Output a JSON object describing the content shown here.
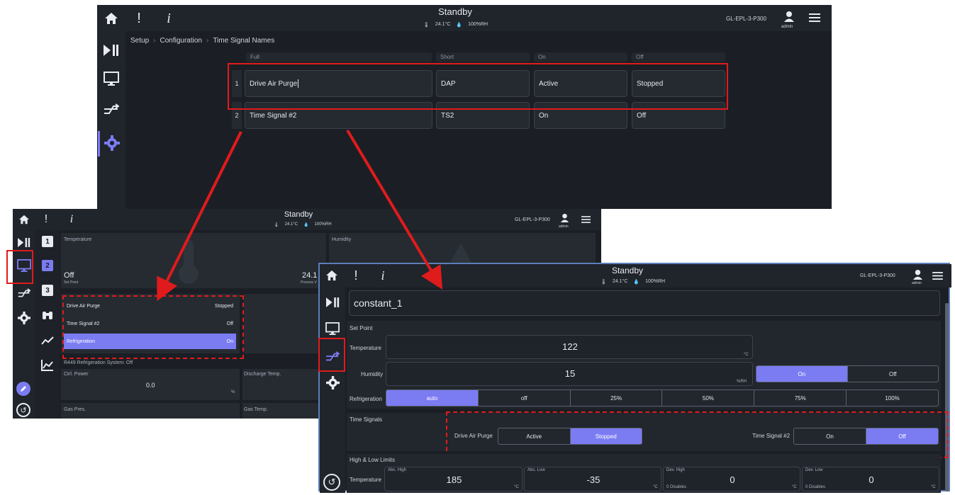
{
  "top": {
    "status": "Standby",
    "temp": "24.1°C",
    "humidity": "100%RH",
    "device": "GL-EPL-3-P300",
    "user": "admin",
    "breadcrumb": [
      "Setup",
      "Configuration",
      "Time Signal Names"
    ],
    "columns": [
      "Full",
      "Short",
      "On",
      "Off"
    ],
    "rows": [
      {
        "num": "1",
        "full": "Drive Air Purge",
        "short": "DAP",
        "on": "Active",
        "off": "Stopped"
      },
      {
        "num": "2",
        "full": "Time Signal #2",
        "short": "TS2",
        "on": "On",
        "off": "Off"
      }
    ]
  },
  "left": {
    "status": "Standby",
    "temp": "24.1°C",
    "humidity": "100%RH",
    "device": "GL-EPL-3-P300",
    "user": "admin",
    "tabs": [
      "1",
      "2",
      "3"
    ],
    "temperature_title": "Temperature",
    "humidity_title": "Humidity",
    "temp_setpoint_value": "Off",
    "temp_setpoint_label": "Set Point",
    "temp_process_value": "24.1",
    "temp_process_label": "Process V",
    "signals": [
      {
        "name": "Drive Air Purge",
        "state": "Stopped",
        "active": false
      },
      {
        "name": "Time Signal #2",
        "state": "Off",
        "active": false
      },
      {
        "name": "Refrigeration",
        "state": "On",
        "active": true
      }
    ],
    "refrig_system": "R449 Refrigeration System: Off",
    "ctrl_power_label": "Ctrl. Power",
    "ctrl_power_value": "0.0",
    "ctrl_power_unit": "%",
    "discharge_label": "Discharge Temp.",
    "gas_pres_label": "Gas Pres.",
    "gas_temp_label": "Gas Temp."
  },
  "right": {
    "status": "Standby",
    "temp": "24.1°C",
    "humidity": "100%RH",
    "device": "GL-EPL-3-P300",
    "user": "admin",
    "name": "constant_1",
    "setpoint_title": "Set Point",
    "temperature_label": "Temperature",
    "temperature_value": "122",
    "temperature_unit": "°C",
    "humidity_label": "Humidity",
    "humidity_value": "15",
    "humidity_unit": "%RH",
    "humidity_on": "On",
    "humidity_off": "Off",
    "refrigeration_label": "Refrigeration",
    "refrigeration_options": [
      "auto",
      "off",
      "25%",
      "50%",
      "75%",
      "100%"
    ],
    "time_signals_title": "Time Signals",
    "ts1_label": "Drive Air Purge",
    "ts1_options": [
      "Active",
      "Stopped"
    ],
    "ts2_label": "Time Signal #2",
    "ts2_options": [
      "On",
      "Off"
    ],
    "limits_title": "High & Low Limits",
    "limits_row_label": "Temperature",
    "abs_high_label": "Abs. High",
    "abs_high_value": "185",
    "abs_low_label": "Abs. Low",
    "abs_low_value": "-35",
    "dev_high_label": "Dev. High",
    "dev_high_value": "0",
    "dev_low_label": "Dev. Low",
    "dev_low_value": "0",
    "unit_c": "°C",
    "disables": "0 Disables"
  },
  "colors": {
    "accent": "#7b7cf2",
    "highlight": "#e01b1b",
    "bg": "#1b1f25"
  }
}
